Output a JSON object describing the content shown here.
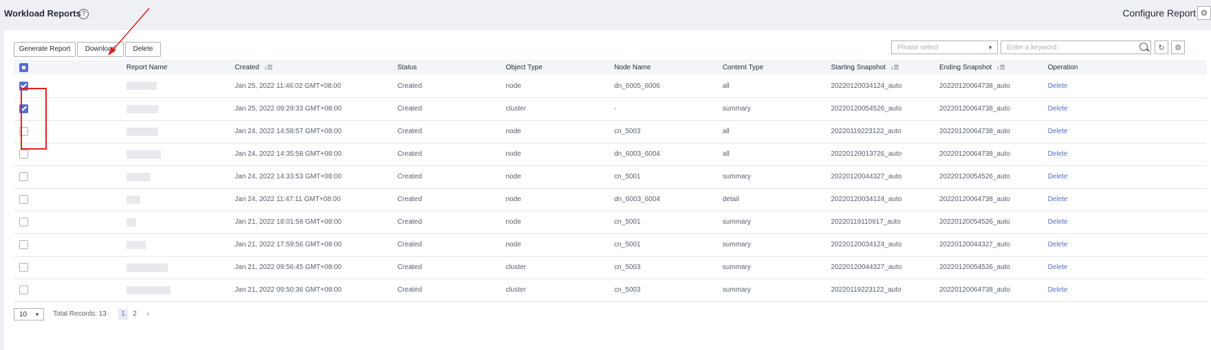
{
  "header": {
    "title": "Workload Reports",
    "help_icon": "question-circle-icon",
    "configure_label": "Configure Report",
    "configure_icon": "gear-icon"
  },
  "toolbar": {
    "generate_label": "Generate Report",
    "download_label": "Download",
    "delete_label": "Delete",
    "select_placeholder": "Please select",
    "search_placeholder": "Enter a keyword."
  },
  "table": {
    "headers": {
      "report_name": "Report Name",
      "created": "Created",
      "status": "Status",
      "object_type": "Object Type",
      "node_name": "Node Name",
      "content_type": "Content Type",
      "starting_snapshot": "Starting Snapshot",
      "ending_snapshot": "Ending Snapshot",
      "operation": "Operation"
    },
    "rows": [
      {
        "checked": true,
        "created": "Jan 25, 2022 11:46:02 GMT+08:00",
        "status": "Created",
        "object_type": "node",
        "node_name": "dn_6005_6006",
        "content_type": "all",
        "start": "20220120034124_auto",
        "end": "20220120064738_auto",
        "op": "Delete"
      },
      {
        "checked": true,
        "created": "Jan 25, 2022 09:29:33 GMT+08:00",
        "status": "Created",
        "object_type": "cluster",
        "node_name": "-",
        "content_type": "summary",
        "start": "20220120054526_auto",
        "end": "20220120064738_auto",
        "op": "Delete"
      },
      {
        "checked": false,
        "created": "Jan 24, 2022 14:58:57 GMT+08:00",
        "status": "Created",
        "object_type": "node",
        "node_name": "cn_5003",
        "content_type": "all",
        "start": "20220119223122_auto",
        "end": "20220120064738_auto",
        "op": "Delete"
      },
      {
        "checked": false,
        "created": "Jan 24, 2022 14:35:58 GMT+08:00",
        "status": "Created",
        "object_type": "node",
        "node_name": "dn_6003_6004",
        "content_type": "all",
        "start": "20220120013726_auto",
        "end": "20220120064738_auto",
        "op": "Delete"
      },
      {
        "checked": false,
        "created": "Jan 24, 2022 14:33:53 GMT+08:00",
        "status": "Created",
        "object_type": "node",
        "node_name": "cn_5001",
        "content_type": "summary",
        "start": "20220120044327_auto",
        "end": "20220120054526_auto",
        "op": "Delete"
      },
      {
        "checked": false,
        "created": "Jan 24, 2022 11:47:11 GMT+08:00",
        "status": "Created",
        "object_type": "node",
        "node_name": "dn_6003_6004",
        "content_type": "detail",
        "start": "20220120034124_auto",
        "end": "20220120064738_auto",
        "op": "Delete"
      },
      {
        "checked": false,
        "created": "Jan 21, 2022 18:01:58 GMT+08:00",
        "status": "Created",
        "object_type": "node",
        "node_name": "cn_5001",
        "content_type": "summary",
        "start": "20220119110917_auto",
        "end": "20220120054526_auto",
        "op": "Delete"
      },
      {
        "checked": false,
        "created": "Jan 21, 2022 17:59:56 GMT+08:00",
        "status": "Created",
        "object_type": "node",
        "node_name": "cn_5001",
        "content_type": "summary",
        "start": "20220120034124_auto",
        "end": "20220120044327_auto",
        "op": "Delete"
      },
      {
        "checked": false,
        "created": "Jan 21, 2022 09:56:45 GMT+08:00",
        "status": "Created",
        "object_type": "cluster",
        "node_name": "cn_5003",
        "content_type": "summary",
        "start": "20220120044327_auto",
        "end": "20220120054526_auto",
        "op": "Delete"
      },
      {
        "checked": false,
        "created": "Jan 21, 2022 09:50:36 GMT+08:00",
        "status": "Created",
        "object_type": "cluster",
        "node_name": "cn_5003",
        "content_type": "summary",
        "start": "20220119223122_auto",
        "end": "20220120064738_auto",
        "op": "Delete"
      }
    ]
  },
  "pagination": {
    "page_size": "10",
    "total": "Total Records: 13",
    "pages": [
      "1",
      "2"
    ],
    "current": "1"
  },
  "colors": {
    "accent": "#526ecc",
    "annotation": "#e0201c"
  }
}
